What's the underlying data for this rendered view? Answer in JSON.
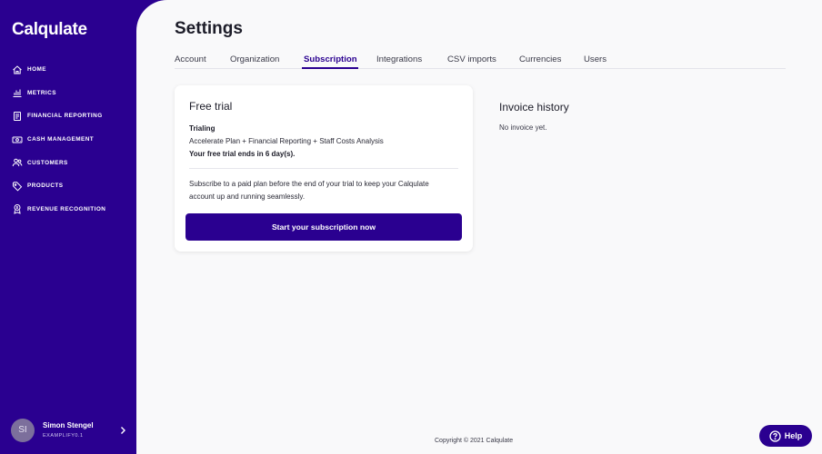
{
  "app": {
    "logo": "Calqulate",
    "accent_color": "#2a0090"
  },
  "sidebar": {
    "items": [
      {
        "label": "HOME",
        "icon": "home-icon"
      },
      {
        "label": "METRICS",
        "icon": "bar-chart-icon"
      },
      {
        "label": "FINANCIAL REPORTING",
        "icon": "report-icon"
      },
      {
        "label": "CASH MANAGEMENT",
        "icon": "cash-icon"
      },
      {
        "label": "CUSTOMERS",
        "icon": "users-icon"
      },
      {
        "label": "PRODUCTS",
        "icon": "tag-icon"
      },
      {
        "label": "REVENUE RECOGNITION",
        "icon": "revenue-icon"
      }
    ],
    "user": {
      "initials": "SI",
      "name": "Simon Stengel",
      "org": "EXAMPLIFY0.1"
    }
  },
  "header": {
    "title": "Settings"
  },
  "tabs": [
    {
      "label": "Account"
    },
    {
      "label": "Organization"
    },
    {
      "label": "Subscription"
    },
    {
      "label": "Integrations"
    },
    {
      "label": "CSV imports"
    },
    {
      "label": "Currencies"
    },
    {
      "label": "Users"
    }
  ],
  "active_tab": "Subscription",
  "trial_card": {
    "title": "Free trial",
    "status": "Trialing",
    "plan": "Accelerate Plan + Financial Reporting + Staff Costs Analysis",
    "ends": "Your free trial ends in 6 day(s).",
    "note": "Subscribe to a paid plan before the end of your trial to keep your Calqulate account up and running seamlessly.",
    "cta": "Start your subscription now"
  },
  "invoice_history": {
    "title": "Invoice history",
    "empty": "No invoice yet."
  },
  "footer": {
    "copyright": "Copyright © 2021 Calqulate"
  },
  "help": {
    "label": "Help",
    "icon": "question-circle-icon"
  }
}
